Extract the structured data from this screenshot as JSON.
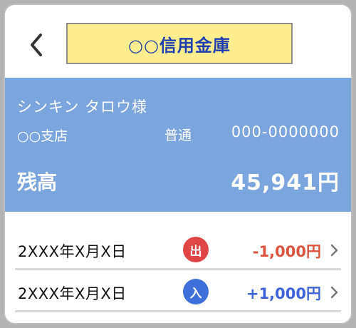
{
  "header": {
    "back_icon": "chevron-left-icon",
    "bank_name": "○○信用金庫",
    "bank_name_bg": "#fcee8e",
    "bank_name_color": "#1f3fae"
  },
  "account": {
    "holder_name": "シンキン タロウ様",
    "branch": "○○支店",
    "type": "普通",
    "number": "000-0000000",
    "balance_label": "残高",
    "balance_value": "45,941円",
    "panel_color": "#7aa6dd"
  },
  "transactions": [
    {
      "date": "2XXX年X月X日",
      "badge": "出",
      "badge_color": "#e04646",
      "amount": "-1,000円",
      "amount_color": "#d9533f"
    },
    {
      "date": "2XXX年X月X日",
      "badge": "入",
      "badge_color": "#3f6fd8",
      "amount": "+1,000円",
      "amount_color": "#3d63d6"
    }
  ]
}
